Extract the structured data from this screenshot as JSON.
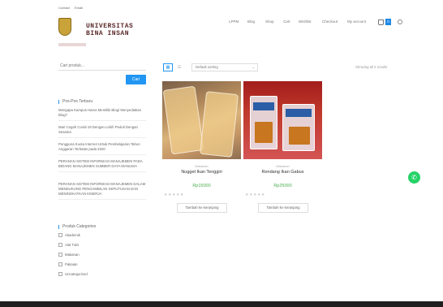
{
  "topbar": {
    "links": [
      "Contact",
      "Email"
    ]
  },
  "brand": {
    "line1": "UNIVERSITAS",
    "line2": "BINA INSAN"
  },
  "nav": {
    "items": [
      "LPPM",
      "Blog",
      "Shop",
      "Cart",
      "Wishlist",
      "Checkout",
      "My account"
    ],
    "cart_count": "0"
  },
  "search": {
    "placeholder": "Cari produk...",
    "button_label": "Cari"
  },
  "recent_posts": {
    "title": "Pos-Pos Terbaru",
    "items": [
      "Mengapa Kampus Harus Memiliki Blog/ Menyediakan Blog?",
      "Mari Cegah Covid-19 Dengan Lebih Peduli Dengan Sesama",
      "Pengguna Kuota Internet Untuk Pembelajaran Tahun Anggaran Terbatas pada 2020",
      "PERANAN SISTEM INFORMASI MANAJEMEN PADA BIDANG MANAJEMEN SUMBER DAYA MANUSIA",
      "PERANAN SISTEM INFORMASI MANAJEMEN DALAM MENDUKUNG PENGAMBILAN KEPUTUSAN DAN MENINGKATKAN KINERJA"
    ]
  },
  "categories": {
    "title": "Produk Categories",
    "items": [
      "Akademik",
      "Alat Tulis",
      "Makanan",
      "Pakaian",
      "Uncategorized"
    ]
  },
  "toolbar": {
    "grid_icon": "grid-icon",
    "list_icon": "list-icon",
    "sort_label": "Default sorting",
    "result_count": "Showing all 2 results"
  },
  "products": [
    {
      "category": "Makanan",
      "name": "Nugget Ikan Tenggiri",
      "price": "Rp15000",
      "stars": "★★★★★",
      "button": "Tambah ke keranjang"
    },
    {
      "category": "Makanan",
      "name": "Rendang Ikan Gabus",
      "price": "Rp25000",
      "stars": "★★★★★",
      "button": "Tambah ke keranjang"
    }
  ],
  "colors": {
    "accent": "#2196f3",
    "price": "#4caf50",
    "whatsapp": "#25d366",
    "footer": "#1f1f1f"
  }
}
